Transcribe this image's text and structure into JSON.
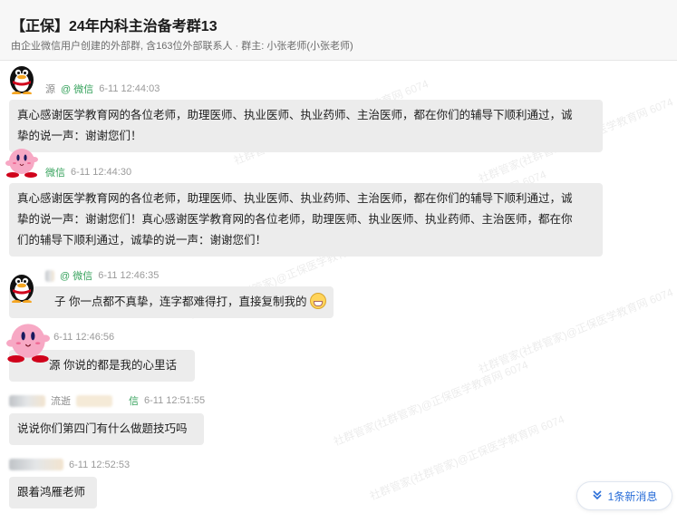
{
  "header": {
    "title": "【正保】24年内科主治备考群13",
    "subtitle": "由企业微信用户创建的外部群, 含163位外部联系人 · 群主: 小张老师(小张老师)"
  },
  "messages": [
    {
      "name_fragment": "源",
      "source": "@ 微信",
      "time": "6-11 12:44:03",
      "avatar": "penguin-avatar",
      "lines": [
        "真心感谢医学教育网的各位老师，助理医师、执业医师、执业药师、主治医师，都在你们的辅导下顺利通过，诚",
        "挚的说一声：谢谢您们！"
      ]
    },
    {
      "name_fragment": "",
      "source": "微信",
      "time": "6-11 12:44:30",
      "avatar": "pink-creature-avatar",
      "lines": [
        "真心感谢医学教育网的各位老师，助理医师、执业医师、执业药师、主治医师，都在你们的辅导下顺利通过，诚",
        "挚的说一声：谢谢您们！真心感谢医学教育网的各位老师，助理医师、执业医师、执业药师、主治医师，都在你",
        "们的辅导下顺利通过，诚挚的说一声：谢谢您们！"
      ]
    },
    {
      "name_fragment": "",
      "source": "@ 微信",
      "time": "6-11 12:46:35",
      "avatar": "penguin-avatar",
      "lines": [
        "子 你一点都不真挚，连字都难得打，直接复制我的"
      ]
    },
    {
      "name_fragment": "",
      "source": "",
      "time": "6-11 12:46:56",
      "avatar": "pink-creature-avatar",
      "lines": [
        "源 你说的都是我的心里话"
      ]
    },
    {
      "name_fragment": "流逝",
      "source": "信",
      "time": "6-11 12:51:55",
      "avatar": "",
      "lines": [
        "说说你们第四门有什么做题技巧吗"
      ]
    },
    {
      "name_fragment": "",
      "source": "",
      "time": "6-11 12:52:53",
      "avatar": "",
      "lines": [
        "跟着鸿雁老师"
      ]
    }
  ],
  "watermark_text": "社群管家(社群管家)@正保医学教育网 6074",
  "new_message_button": {
    "label": "1条新消息",
    "icon": "chevron-double-down-icon"
  }
}
